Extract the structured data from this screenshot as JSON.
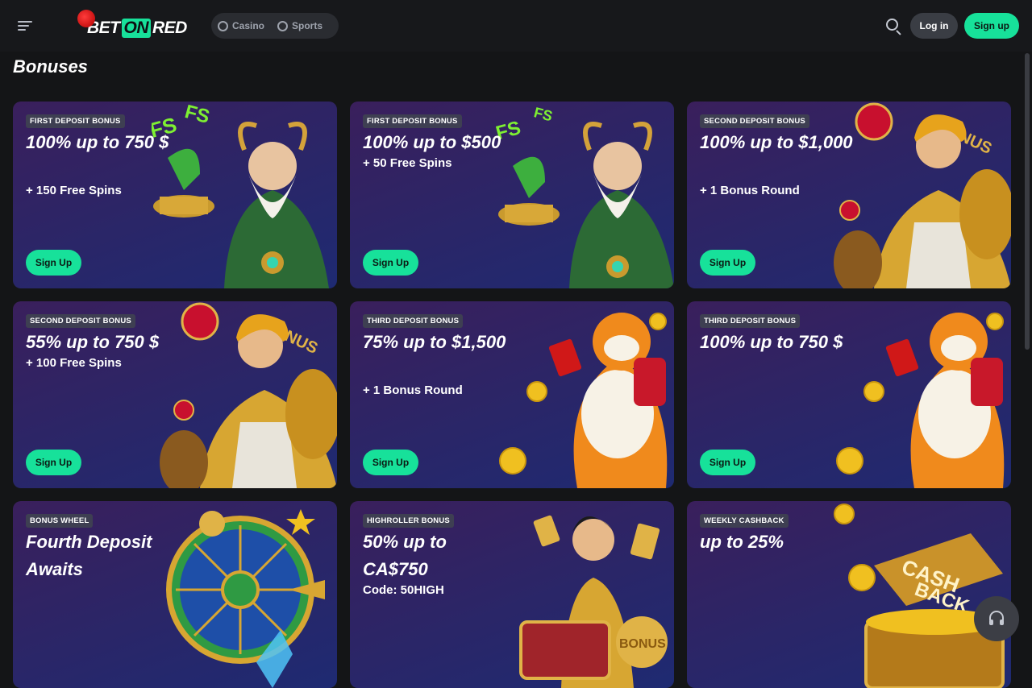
{
  "header": {
    "logo": {
      "bet": "BET",
      "on": "ON",
      "red": "RED"
    },
    "nav": [
      {
        "label": "Casino",
        "icon": "casino-chip-icon"
      },
      {
        "label": "Sports",
        "icon": "soccer-ball-icon"
      }
    ],
    "login_label": "Log in",
    "signup_label": "Sign up"
  },
  "page": {
    "title": "Bonuses"
  },
  "cards": [
    {
      "badge": "FIRST DEPOSIT BONUS",
      "title": "100% up to 750 $",
      "subtitle": "+ 150 Free Spins",
      "button": "Sign Up",
      "art": "wizard-art"
    },
    {
      "badge": "FIRST DEPOSIT BONUS",
      "title": "100% up to $500",
      "subtitle": "+ 50 Free Spins",
      "button": "Sign Up",
      "art": "wizard-art"
    },
    {
      "badge": "SECOND DEPOSIT BONUS",
      "title": "100% up to $1,000",
      "subtitle": "+ 1 Bonus Round",
      "button": "Sign Up",
      "art": "warrior-art"
    },
    {
      "badge": "SECOND DEPOSIT BONUS",
      "title": "55% up to 750 $",
      "subtitle": "+ 100 Free Spins",
      "button": "Sign Up",
      "art": "warrior-art"
    },
    {
      "badge": "THIRD DEPOSIT BONUS",
      "title": "75% up to $1,500",
      "subtitle": "+ 1 Bonus Round",
      "button": "Sign Up",
      "art": "tiger-art"
    },
    {
      "badge": "THIRD DEPOSIT BONUS",
      "title": "100% up to 750 $",
      "subtitle": "",
      "button": "Sign Up",
      "art": "tiger-art"
    },
    {
      "badge": "BONUS WHEEL",
      "title": "Fourth Deposit Awaits",
      "subtitle": "",
      "button": "",
      "art": "wheel-art"
    },
    {
      "badge": "HIGHROLLER BONUS",
      "title": "50% up to CA$750",
      "subtitle": "Code: 50HIGH",
      "button": "",
      "art": "treasure-art"
    },
    {
      "badge": "WEEKLY CASHBACK",
      "title": "up to 25%",
      "subtitle": "",
      "button": "",
      "art": "cashback-chest-art"
    }
  ],
  "colors": {
    "accent": "#17e19a",
    "background": "#141517",
    "header": "#17181b"
  }
}
